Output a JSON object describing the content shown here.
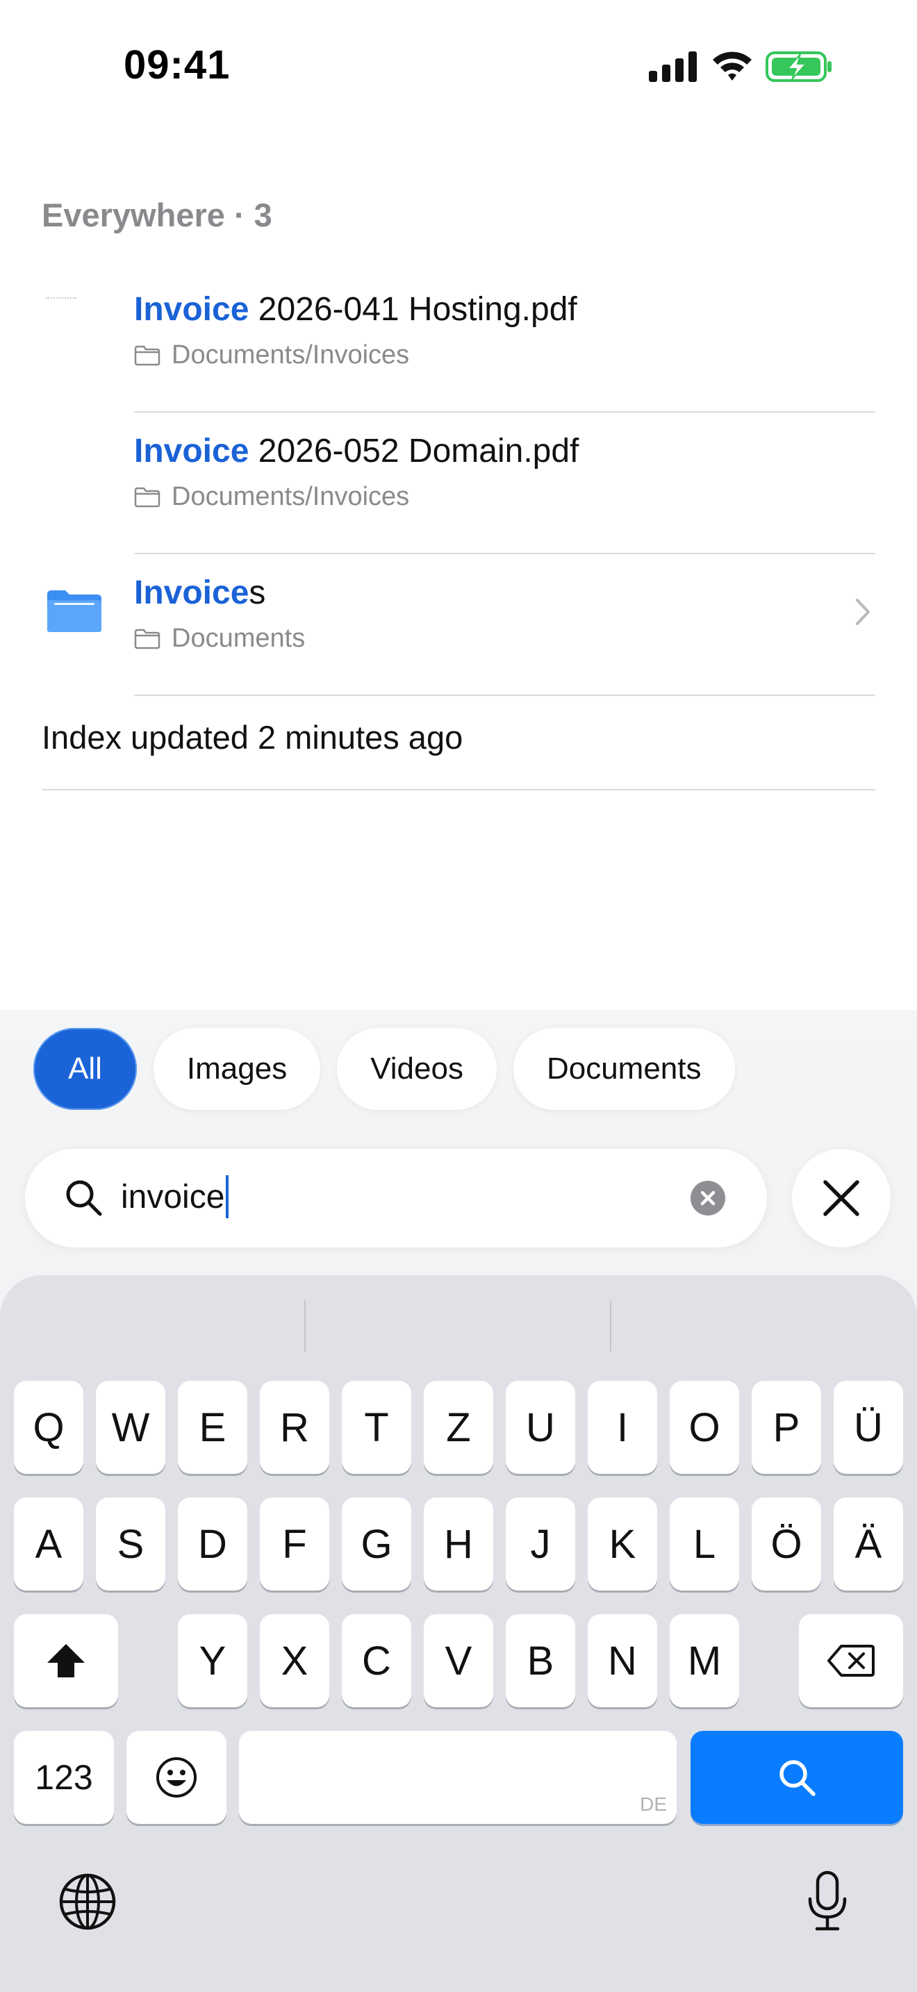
{
  "status_bar": {
    "time": "09:41"
  },
  "results": {
    "section_title": "Everywhere · 3",
    "items": [
      {
        "title_highlight": "Invoice",
        "title_rest": " 2026-041 Hosting.pdf",
        "path": "Documents/Invoices",
        "kind": "pdf"
      },
      {
        "title_highlight": "Invoice",
        "title_rest": " 2026-052 Domain.pdf",
        "path": "Documents/Invoices",
        "kind": "pdf"
      },
      {
        "title_highlight": "Invoice",
        "title_rest": "s",
        "path": "Documents",
        "kind": "folder"
      }
    ],
    "index_status": "Index updated 2 minutes ago"
  },
  "filters": {
    "chips": [
      {
        "label": "All",
        "active": true
      },
      {
        "label": "Images",
        "active": false
      },
      {
        "label": "Videos",
        "active": false
      },
      {
        "label": "Documents",
        "active": false
      }
    ]
  },
  "search": {
    "value": "invoice"
  },
  "keyboard": {
    "row1": [
      "Q",
      "W",
      "E",
      "R",
      "T",
      "Z",
      "U",
      "I",
      "O",
      "P",
      "Ü"
    ],
    "row2": [
      "A",
      "S",
      "D",
      "F",
      "G",
      "H",
      "J",
      "K",
      "L",
      "Ö",
      "Ä"
    ],
    "row3": [
      "Y",
      "X",
      "C",
      "V",
      "B",
      "N",
      "M"
    ],
    "numbers_label": "123",
    "space_hint": "DE"
  },
  "colors": {
    "accent": "#1b64d8",
    "search_key": "#0a7cff",
    "highlight_text": "#1a62d6",
    "folder_blue": "#4a9df8"
  },
  "icons": [
    "signal-icon",
    "wifi-icon",
    "battery-charging-icon",
    "folder-icon",
    "chevron-right-icon",
    "search-icon",
    "clear-icon",
    "close-icon",
    "shift-icon",
    "backspace-icon",
    "emoji-icon",
    "globe-icon",
    "mic-icon"
  ]
}
